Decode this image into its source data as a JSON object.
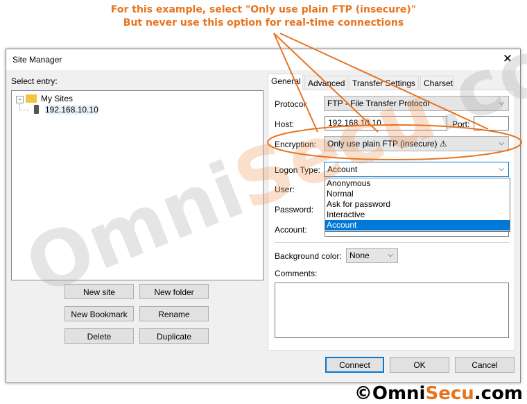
{
  "annotation": {
    "line1": "For this example, select \"Only use plain FTP (insecure)\"",
    "line2": "But never use this option for real-time connections"
  },
  "window": {
    "title": "Site Manager",
    "close_glyph": "✕"
  },
  "left": {
    "select_entry_label": "Select entry:",
    "tree": {
      "root_label": "My Sites",
      "child_label": "192.168.10.10",
      "expander": "−"
    },
    "buttons": {
      "new_site": "New site",
      "new_folder": "New folder",
      "new_bookmark": "New Bookmark",
      "rename": "Rename",
      "delete": "Delete",
      "duplicate": "Duplicate"
    }
  },
  "tabs": [
    "General",
    "Advanced",
    "Transfer Settings",
    "Charset"
  ],
  "general": {
    "protocol_label": "Protocol:",
    "protocol_value": "FTP - File Transfer Protocol",
    "host_label": "Host:",
    "host_value": "192.168.10.10",
    "port_label": "Port:",
    "port_value": "",
    "encryption_label": "Encryption:",
    "encryption_value": "Only use plain FTP (insecure) ⚠",
    "logon_type_label": "Logon Type:",
    "logon_type_value": "Account",
    "logon_options": [
      "Anonymous",
      "Normal",
      "Ask for password",
      "Interactive",
      "Account"
    ],
    "logon_selected_index": 4,
    "user_label": "User:",
    "password_label": "Password:",
    "account_label": "Account:",
    "bg_color_label": "Background color:",
    "bg_color_value": "None",
    "comments_label": "Comments:"
  },
  "footer": {
    "connect": "Connect",
    "ok": "OK",
    "cancel": "Cancel"
  },
  "watermark": {
    "omni": "Omni",
    "secu": "Secu",
    "com": ".com"
  },
  "copyright": {
    "symbol": "©",
    "omni": "Omni",
    "secu": "Secu",
    "com": ".com"
  },
  "colors": {
    "accent_orange": "#e8731d",
    "selection_blue": "#0078d7"
  }
}
